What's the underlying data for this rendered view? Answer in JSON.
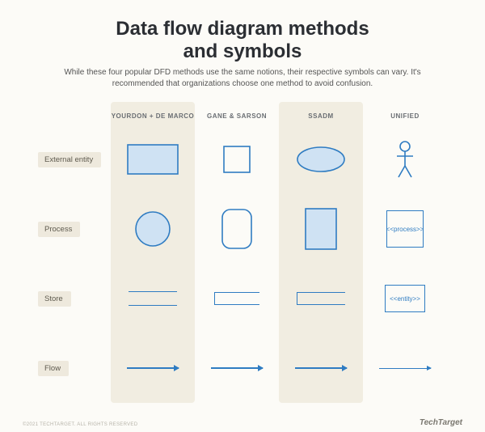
{
  "title_line1": "Data flow diagram methods",
  "title_line2": "and symbols",
  "subtitle": "While these four popular DFD methods use the same notions, their respective symbols can vary. It's recommended that organizations choose one method to avoid confusion.",
  "columns": {
    "c1": "YOURDON + DE MARCO",
    "c2": "GANE & SARSON",
    "c3": "SSADM",
    "c4": "UNIFIED"
  },
  "rows": {
    "r1": "External entity",
    "r2": "Process",
    "r3": "Store",
    "r4": "Flow"
  },
  "uml": {
    "process": "<<process>>",
    "entity": "<<entity>>"
  },
  "footer": "©2021 TECHTARGET. ALL RIGHTS RESERVED",
  "brand": "TechTarget",
  "colors": {
    "stroke": "#2f7cc2",
    "fill": "#cfe2f3",
    "highlight_col": "#f1ede1",
    "rowlabel_bg": "#eee9dd"
  }
}
